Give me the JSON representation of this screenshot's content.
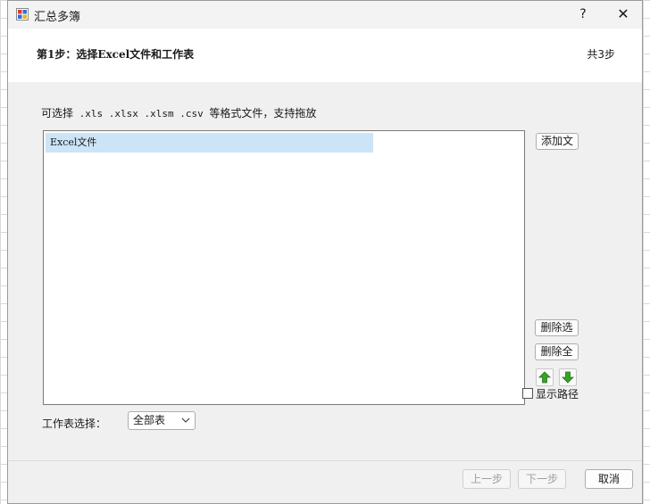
{
  "window": {
    "title": "汇总多簿",
    "help_label": "?",
    "close_label": "✕"
  },
  "header": {
    "step_title": "第1步：选择Excel文件和工作表",
    "step_count": "共3步"
  },
  "hint": {
    "prefix": "可选择",
    "formats": " .xls  .xlsx  .xlsm .csv ",
    "suffix": "等格式文件，支持拖放"
  },
  "file_list": {
    "items": [
      "Excel文件"
    ]
  },
  "side_buttons": {
    "add": "添加文",
    "delete_selected": "删除选",
    "delete_all": "删除全",
    "move_up": "up-arrow-icon",
    "move_down": "down-arrow-icon"
  },
  "show_path": {
    "label": "显示路径",
    "checked": false
  },
  "sheet_select": {
    "label": "工作表选择：",
    "value": "全部表"
  },
  "footer": {
    "prev": "上一步",
    "next": "下一步",
    "cancel": "取消"
  },
  "colors": {
    "selection": "#cce4f7",
    "arrow_green": "#3aa12b"
  }
}
